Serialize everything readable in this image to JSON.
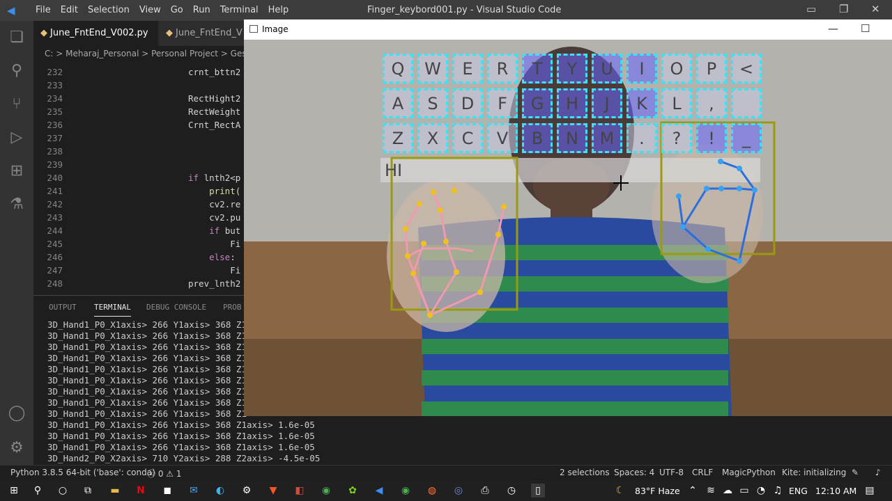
{
  "titlebar": {
    "menu": [
      "File",
      "Edit",
      "Selection",
      "View",
      "Go",
      "Run",
      "Terminal",
      "Help"
    ],
    "window_title": "Finger_keybord001.py - Visual Studio Code"
  },
  "tabs": [
    "June_FntEnd_V002.py",
    "June_FntEnd_V"
  ],
  "breadcrumb": "C: > Meharaj_Personal > Personal Project > Gestu",
  "editor_lines": [
    {
      "num": "232",
      "code": "crnt_bttn2"
    },
    {
      "num": "233",
      "code": ""
    },
    {
      "num": "234",
      "code": "RectHight2"
    },
    {
      "num": "235",
      "code": "RectWeight"
    },
    {
      "num": "236",
      "code": "Crnt_RectA"
    },
    {
      "num": "237",
      "code": ""
    },
    {
      "num": "238",
      "code": ""
    },
    {
      "num": "239",
      "code": ""
    },
    {
      "num": "240",
      "code": "if lnth2<p"
    },
    {
      "num": "241",
      "code": "    print("
    },
    {
      "num": "242",
      "code": "    cv2.re"
    },
    {
      "num": "243",
      "code": "    cv2.pu"
    },
    {
      "num": "244",
      "code": "    if but"
    },
    {
      "num": "245",
      "code": "        Fi"
    },
    {
      "num": "246",
      "code": "    else:"
    },
    {
      "num": "247",
      "code": "        Fi"
    },
    {
      "num": "248",
      "code": "prev_lnth2"
    }
  ],
  "panel_tabs": [
    "OUTPUT",
    "TERMINAL",
    "DEBUG CONSOLE",
    "PROB"
  ],
  "terminal_lines": [
    "3D_Hand1_P0_X1axis> 266 Y1axis> 368 Z1",
    "3D_Hand1_P0_X1axis> 266 Y1axis> 368 Z1",
    "3D_Hand1_P0_X1axis> 266 Y1axis> 368 Z1",
    "3D_Hand1_P0_X1axis> 266 Y1axis> 368 Z1",
    "3D_Hand1_P0_X1axis> 266 Y1axis> 368 Z1",
    "3D_Hand1_P0_X1axis> 266 Y1axis> 368 Z1",
    "3D_Hand1_P0_X1axis> 266 Y1axis> 368 Z1",
    "3D_Hand1_P0_X1axis> 266 Y1axis> 368 Z1",
    "3D_Hand1_P0_X1axis> 266 Y1axis> 368 Z1",
    "3D_Hand1_P0_X1axis> 266 Y1axis> 368 Z1axis> 1.6e-05",
    "3D_Hand1_P0_X1axis> 266 Y1axis> 368 Z1axis> 1.6e-05",
    "3D_Hand1_P0_X1axis> 266 Y1axis> 368 Z1axis> 1.6e-05",
    "3D_Hand2_P0_X2axis> 710 Y2axis> 288 Z2axis> -4.5e-05"
  ],
  "statusbar": {
    "python": "Python 3.8.5 64-bit ('base': conda)",
    "errors": "ⓧ 0 ⚠ 1",
    "selections": "2 selections",
    "spaces": "Spaces: 4",
    "encoding": "UTF-8",
    "eol": "CRLF",
    "language": "MagicPython",
    "kite": "Kite: initializing"
  },
  "taskbar": {
    "weather": "83°F  Haze",
    "lang": "ENG",
    "time": "12:10 AM"
  },
  "image_window": {
    "title": "Image",
    "typed_text": "HI",
    "keys_row1": [
      "Q",
      "W",
      "E",
      "R",
      "T",
      "Y",
      "U",
      "I",
      "O",
      "P",
      "<"
    ],
    "keys_row2": [
      "A",
      "S",
      "D",
      "F",
      "G",
      "H",
      "J",
      "K",
      "L",
      ",",
      ""
    ],
    "keys_row3": [
      "Z",
      "X",
      "C",
      "V",
      "B",
      "N",
      "M",
      ".",
      "?",
      "!",
      "_"
    ]
  }
}
